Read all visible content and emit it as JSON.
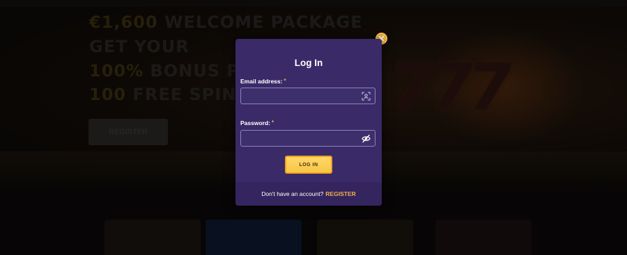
{
  "background": {
    "hero_lines": [
      {
        "highlight": "€1,600",
        "text": " WELCOME PACKAGE"
      },
      {
        "highlight": "",
        "text": "GET YOUR"
      },
      {
        "highlight": "100%",
        "text": " BONUS P"
      },
      {
        "highlight": "100",
        "text": " FREE SPINS"
      }
    ],
    "hero_button_label": "REGISTER",
    "hero_art_text": "777"
  },
  "modal": {
    "title": "Log In",
    "close_icon": "close-icon",
    "email": {
      "label": "Email address:",
      "required_mark": "*",
      "value": "",
      "icon": "autofill-icon"
    },
    "password": {
      "label": "Password:",
      "required_mark": "*",
      "value": "",
      "icon": "eye-slash-icon"
    },
    "login_button_label": "LOG IN",
    "footer": {
      "prompt": "Don't have an account?",
      "register_link": "REGISTER"
    }
  },
  "colors": {
    "modal_bg": "#3a2a68",
    "accent": "#f8c646",
    "link": "#f3b04c",
    "close": "#f5b23a"
  }
}
